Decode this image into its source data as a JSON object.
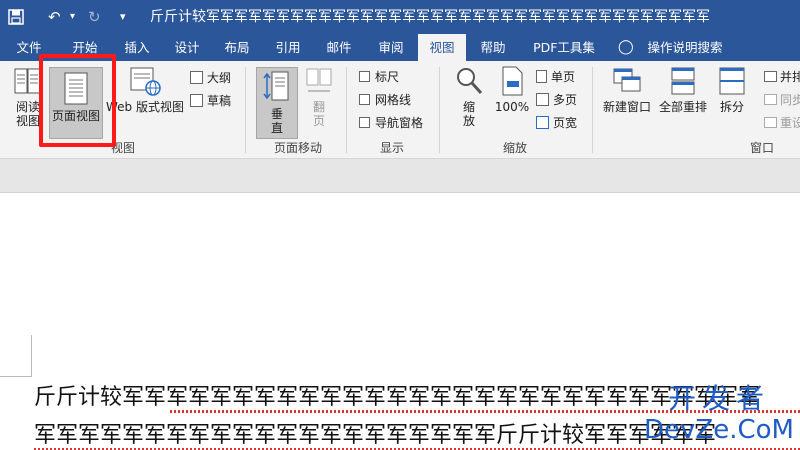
{
  "titlebar": {
    "save_icon": "save-icon",
    "undo_icon": "undo-icon",
    "redo_icon": "redo-icon",
    "customize_icon": "dropdown-icon",
    "title": "斤斤计较军军军军军军军军军军军军军军军军军军军军军军军军军军军军军军军军军军军军"
  },
  "tabs": [
    "文件",
    "开始",
    "插入",
    "设计",
    "布局",
    "引用",
    "邮件",
    "审阅",
    "视图",
    "帮助",
    "PDF工具集",
    "操作说明搜索"
  ],
  "active_tab": "视图",
  "ribbon": {
    "views": {
      "label": "视图",
      "read_mode": "阅读\n视图",
      "print_layout": "页面视图",
      "web_layout": "Web 版式视图",
      "outline": "大纲",
      "draft": "草稿"
    },
    "page_movement": {
      "label": "页面移动",
      "vertical": "垂\n直",
      "side_to_side": "翻\n页"
    },
    "show": {
      "label": "显示",
      "ruler": "标尺",
      "gridlines": "网格线",
      "navigation_pane": "导航窗格"
    },
    "zoom": {
      "label": "缩放",
      "zoom": "缩\n放",
      "percent": "100%",
      "one_page": "单页",
      "multiple_pages": "多页",
      "page_width": "页宽"
    },
    "window": {
      "label": "窗口",
      "new_window": "新建窗口",
      "arrange_all": "全部重排",
      "split": "拆分",
      "side_by_side": "并排",
      "sync_scroll": "同步",
      "reset_position": "重设"
    }
  },
  "document": {
    "line1": "斤斤计较军军军军军军军军军军军军军军军军军军军军军军军军军军军军军",
    "line2": "军军军军军军军军军军军军军军军军军军军军军斤斤计较军军军军军军"
  },
  "watermark": {
    "top": "开发者",
    "bottom": "DevZe.CoM"
  },
  "colors": {
    "accent": "#2b579a",
    "highlight": "#ff1a1a",
    "watermark": "#1f5cc6"
  }
}
